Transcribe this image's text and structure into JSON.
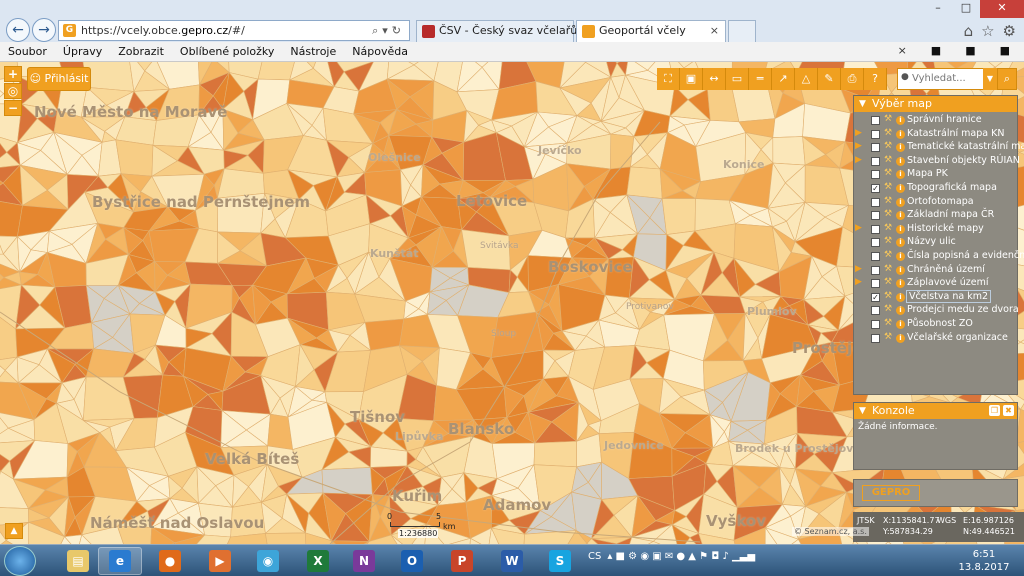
{
  "browser": {
    "url_prefix": "https://vcely.obce.",
    "url_host": "gepro.cz",
    "url_suffix": "/#/",
    "tabs": [
      {
        "label": "ČSV - Český svaz včelařů",
        "active": false
      },
      {
        "label": "Geoportál včely",
        "active": true
      }
    ],
    "menu": [
      "Soubor",
      "Úpravy",
      "Zobrazit",
      "Oblíbené položky",
      "Nástroje",
      "Nápověda"
    ]
  },
  "app": {
    "login_label": "Přihlásit",
    "search_placeholder": "Vyhledat...",
    "zoom_in": "+",
    "zoom_out": "−",
    "accent_color": "#f0a020"
  },
  "layers_panel": {
    "title": "Výběr map",
    "layers": [
      {
        "label": "Správní hranice",
        "checked": false,
        "expandable": false
      },
      {
        "label": "Katastrální mapa KN",
        "checked": false,
        "expandable": true
      },
      {
        "label": "Tematické katastrální mapy",
        "checked": false,
        "expandable": true
      },
      {
        "label": "Stavební objekty RÚIAN",
        "checked": false,
        "expandable": true
      },
      {
        "label": "Mapa PK",
        "checked": false,
        "expandable": false
      },
      {
        "label": "Topografická mapa",
        "checked": true,
        "expandable": false
      },
      {
        "label": "Ortofotomapa",
        "checked": false,
        "expandable": false
      },
      {
        "label": "Základní mapa ČR",
        "checked": false,
        "expandable": false
      },
      {
        "label": "Historické mapy",
        "checked": false,
        "expandable": true
      },
      {
        "label": "Názvy ulic",
        "checked": false,
        "expandable": false
      },
      {
        "label": "Čísla popisná a evidenční",
        "checked": false,
        "expandable": false
      },
      {
        "label": "Chráněná území",
        "checked": false,
        "expandable": true
      },
      {
        "label": "Záplavové území",
        "checked": false,
        "expandable": true
      },
      {
        "label": "Včelstva na km2",
        "checked": true,
        "expandable": false,
        "selected": true
      },
      {
        "label": "Prodejci medu ze dvora",
        "checked": false,
        "expandable": false
      },
      {
        "label": "Působnost ZO",
        "checked": false,
        "expandable": false
      },
      {
        "label": "Včelařské organizace",
        "checked": false,
        "expandable": false
      }
    ]
  },
  "console_panel": {
    "title": "Konzole",
    "message": "Žádné informace."
  },
  "branding": {
    "logo_text": "GEPRO"
  },
  "status": {
    "system": "JTSK",
    "x_label": "X:1135841.77",
    "y_label": "Y:587834.29",
    "wgs": "WGS",
    "e_label": "E:16.987126",
    "n_label": "N:49.446521"
  },
  "scale": {
    "start": "0",
    "end": "5",
    "unit": "km",
    "ratio": "1:236880"
  },
  "attribution": "© Seznam.cz, a.s.",
  "map_places": [
    {
      "name": "Nové Město na Moravě",
      "size": "big"
    },
    {
      "name": "Bystřice nad Pernštejnem",
      "size": "big"
    },
    {
      "name": "Letovice",
      "size": "big"
    },
    {
      "name": "Boskovice",
      "size": "big"
    },
    {
      "name": "Tišnov",
      "size": "big"
    },
    {
      "name": "Blansko",
      "size": "big"
    },
    {
      "name": "Velká Bíteš",
      "size": "big"
    },
    {
      "name": "Kuřim",
      "size": "big"
    },
    {
      "name": "Adamov",
      "size": "big"
    },
    {
      "name": "Vyškov",
      "size": "big"
    },
    {
      "name": "Prostějov",
      "size": "big"
    },
    {
      "name": "Náměšť nad Oslavou",
      "size": "big"
    },
    {
      "name": "Olešnice",
      "size": "med"
    },
    {
      "name": "Jevíčko",
      "size": "med"
    },
    {
      "name": "Konice",
      "size": "med"
    },
    {
      "name": "Kunštát",
      "size": "med"
    },
    {
      "name": "Jedovnice",
      "size": "med"
    },
    {
      "name": "Lipůvka",
      "size": "med"
    },
    {
      "name": "Brodek u Prostějova",
      "size": "med"
    },
    {
      "name": "Plumlov",
      "size": "med"
    },
    {
      "name": "Svitávka",
      "size": "sm"
    },
    {
      "name": "Sloup",
      "size": "sm"
    },
    {
      "name": "Protivanov",
      "size": "sm"
    }
  ],
  "taskbar": {
    "lang": "CS",
    "time": "6:51",
    "date": "13.8.2017",
    "apps": [
      "explorer-icon",
      "internet-explorer-icon",
      "firefox-icon",
      "media-player-icon",
      "chrome-icon",
      "excel-icon",
      "onenote-icon",
      "outlook-icon",
      "powerpoint-icon",
      "word-icon",
      "skype-icon"
    ]
  }
}
